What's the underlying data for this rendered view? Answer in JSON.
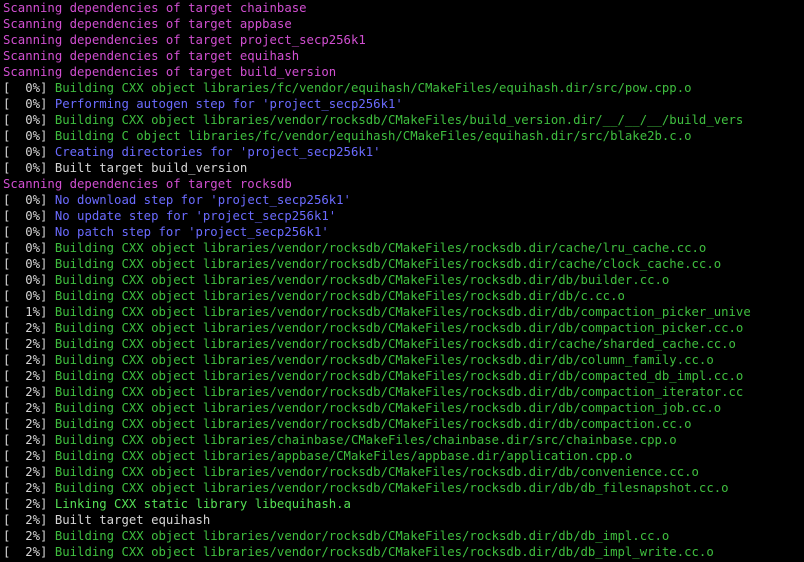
{
  "colors": {
    "background": "#000000",
    "scan": "#d14fd1",
    "build": "#3fbf3f",
    "step": "#6b6bff",
    "plain": "#d6d6d6",
    "link": "#55e055"
  },
  "terminal": {
    "lines": [
      {
        "prefix": "",
        "text": "Scanning dependencies of target chainbase",
        "kind": "scan"
      },
      {
        "prefix": "",
        "text": "Scanning dependencies of target appbase",
        "kind": "scan"
      },
      {
        "prefix": "",
        "text": "Scanning dependencies of target project_secp256k1",
        "kind": "scan"
      },
      {
        "prefix": "",
        "text": "Scanning dependencies of target equihash",
        "kind": "scan"
      },
      {
        "prefix": "",
        "text": "Scanning dependencies of target build_version",
        "kind": "scan"
      },
      {
        "prefix": "[  0%] ",
        "text": "Building CXX object libraries/fc/vendor/equihash/CMakeFiles/equihash.dir/src/pow.cpp.o",
        "kind": "build"
      },
      {
        "prefix": "[  0%] ",
        "text": "Performing autogen step for 'project_secp256k1'",
        "kind": "step"
      },
      {
        "prefix": "[  0%] ",
        "text": "Building CXX object libraries/vendor/rocksdb/CMakeFiles/build_version.dir/__/__/__/build_vers",
        "kind": "build"
      },
      {
        "prefix": "[  0%] ",
        "text": "Building C object libraries/fc/vendor/equihash/CMakeFiles/equihash.dir/src/blake2b.c.o",
        "kind": "build"
      },
      {
        "prefix": "[  0%] ",
        "text": "Creating directories for 'project_secp256k1'",
        "kind": "step"
      },
      {
        "prefix": "[  0%] ",
        "text": "Built target build_version",
        "kind": "plain"
      },
      {
        "prefix": "",
        "text": "Scanning dependencies of target rocksdb",
        "kind": "scan"
      },
      {
        "prefix": "[  0%] ",
        "text": "No download step for 'project_secp256k1'",
        "kind": "step"
      },
      {
        "prefix": "[  0%] ",
        "text": "No update step for 'project_secp256k1'",
        "kind": "step"
      },
      {
        "prefix": "[  0%] ",
        "text": "No patch step for 'project_secp256k1'",
        "kind": "step"
      },
      {
        "prefix": "[  0%] ",
        "text": "Building CXX object libraries/vendor/rocksdb/CMakeFiles/rocksdb.dir/cache/lru_cache.cc.o",
        "kind": "build"
      },
      {
        "prefix": "[  0%] ",
        "text": "Building CXX object libraries/vendor/rocksdb/CMakeFiles/rocksdb.dir/cache/clock_cache.cc.o",
        "kind": "build"
      },
      {
        "prefix": "[  0%] ",
        "text": "Building CXX object libraries/vendor/rocksdb/CMakeFiles/rocksdb.dir/db/builder.cc.o",
        "kind": "build"
      },
      {
        "prefix": "[  0%] ",
        "text": "Building CXX object libraries/vendor/rocksdb/CMakeFiles/rocksdb.dir/db/c.cc.o",
        "kind": "build"
      },
      {
        "prefix": "[  1%] ",
        "text": "Building CXX object libraries/vendor/rocksdb/CMakeFiles/rocksdb.dir/db/compaction_picker_unive",
        "kind": "build"
      },
      {
        "prefix": "[  2%] ",
        "text": "Building CXX object libraries/vendor/rocksdb/CMakeFiles/rocksdb.dir/db/compaction_picker.cc.o",
        "kind": "build"
      },
      {
        "prefix": "[  2%] ",
        "text": "Building CXX object libraries/vendor/rocksdb/CMakeFiles/rocksdb.dir/cache/sharded_cache.cc.o",
        "kind": "build"
      },
      {
        "prefix": "[  2%] ",
        "text": "Building CXX object libraries/vendor/rocksdb/CMakeFiles/rocksdb.dir/db/column_family.cc.o",
        "kind": "build"
      },
      {
        "prefix": "[  2%] ",
        "text": "Building CXX object libraries/vendor/rocksdb/CMakeFiles/rocksdb.dir/db/compacted_db_impl.cc.o",
        "kind": "build"
      },
      {
        "prefix": "[  2%] ",
        "text": "Building CXX object libraries/vendor/rocksdb/CMakeFiles/rocksdb.dir/db/compaction_iterator.cc",
        "kind": "build"
      },
      {
        "prefix": "[  2%] ",
        "text": "Building CXX object libraries/vendor/rocksdb/CMakeFiles/rocksdb.dir/db/compaction_job.cc.o",
        "kind": "build"
      },
      {
        "prefix": "[  2%] ",
        "text": "Building CXX object libraries/vendor/rocksdb/CMakeFiles/rocksdb.dir/db/compaction.cc.o",
        "kind": "build"
      },
      {
        "prefix": "[  2%] ",
        "text": "Building CXX object libraries/chainbase/CMakeFiles/chainbase.dir/src/chainbase.cpp.o",
        "kind": "build"
      },
      {
        "prefix": "[  2%] ",
        "text": "Building CXX object libraries/appbase/CMakeFiles/appbase.dir/application.cpp.o",
        "kind": "build"
      },
      {
        "prefix": "[  2%] ",
        "text": "Building CXX object libraries/vendor/rocksdb/CMakeFiles/rocksdb.dir/db/convenience.cc.o",
        "kind": "build"
      },
      {
        "prefix": "[  2%] ",
        "text": "Building CXX object libraries/vendor/rocksdb/CMakeFiles/rocksdb.dir/db/db_filesnapshot.cc.o",
        "kind": "build"
      },
      {
        "prefix": "[  2%] ",
        "text": "Linking CXX static library libequihash.a",
        "kind": "link"
      },
      {
        "prefix": "[  2%] ",
        "text": "Built target equihash",
        "kind": "plain"
      },
      {
        "prefix": "[  2%] ",
        "text": "Building CXX object libraries/vendor/rocksdb/CMakeFiles/rocksdb.dir/db/db_impl.cc.o",
        "kind": "build"
      },
      {
        "prefix": "[  2%] ",
        "text": "Building CXX object libraries/vendor/rocksdb/CMakeFiles/rocksdb.dir/db/db_impl_write.cc.o",
        "kind": "build"
      }
    ]
  }
}
